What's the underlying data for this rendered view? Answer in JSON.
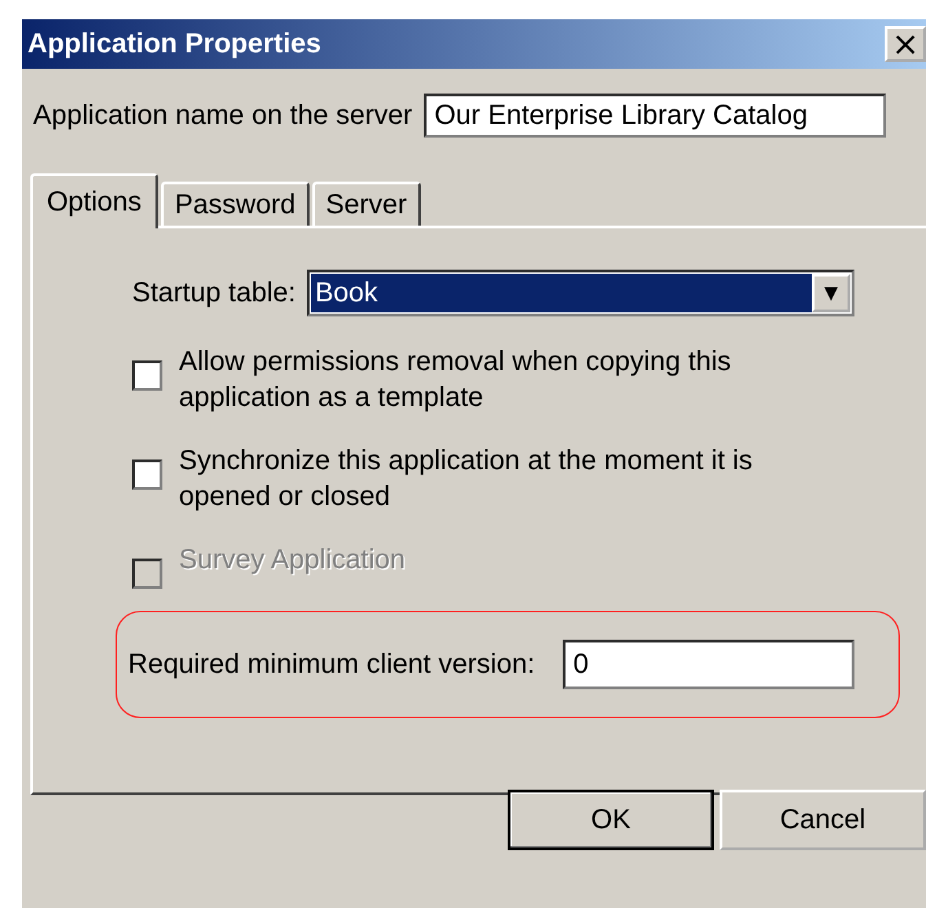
{
  "window": {
    "title": "Application Properties",
    "close": "×"
  },
  "app_name": {
    "label": "Application name on the server",
    "value": "Our Enterprise Library Catalog"
  },
  "tabs": [
    {
      "label": "Options",
      "selected": true
    },
    {
      "label": "Password",
      "selected": false
    },
    {
      "label": "Server",
      "selected": false
    }
  ],
  "startup_table": {
    "label": "Startup table:",
    "value": "Book",
    "arrow": "▼"
  },
  "checkboxes": [
    {
      "label": "Allow permissions removal when copying this application as a template",
      "checked": false,
      "disabled": false
    },
    {
      "label": "Synchronize this application at the moment it is opened or closed",
      "checked": false,
      "disabled": false
    },
    {
      "label": "Survey Application",
      "checked": false,
      "disabled": true
    }
  ],
  "min_version": {
    "label": "Required minimum client version:",
    "value": "0",
    "highlighted": true
  },
  "buttons": [
    {
      "label": "OK",
      "kind": "default"
    },
    {
      "label": "Cancel",
      "kind": "normal"
    }
  ]
}
